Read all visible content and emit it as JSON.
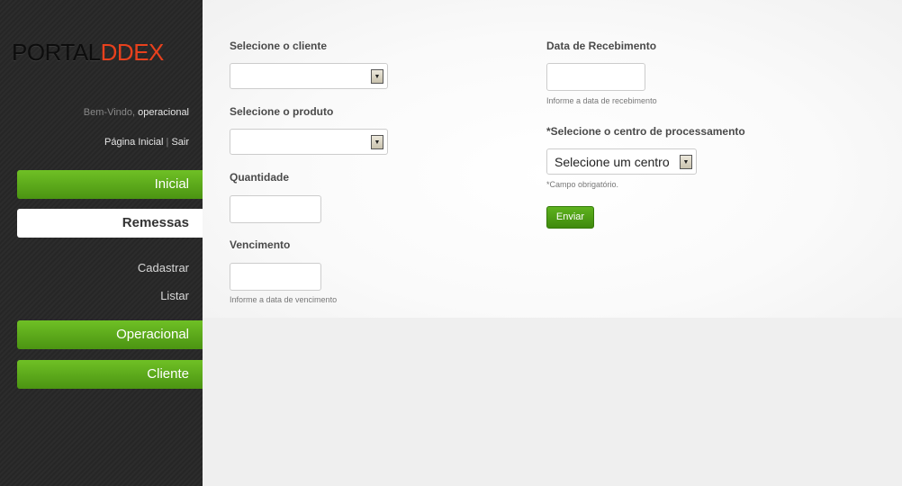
{
  "brand": {
    "part1": "PORTAL",
    "part2": "DDEX"
  },
  "welcome": {
    "prefix": "Bem-Vindo, ",
    "user": "operacional"
  },
  "links": {
    "home": "Página Inicial",
    "separator": " | ",
    "logout": "Sair"
  },
  "nav": {
    "inicial": "Inicial",
    "remessas": "Remessas",
    "cadastrar": "Cadastrar",
    "listar": "Listar",
    "operacional": "Operacional",
    "cliente": "Cliente"
  },
  "form": {
    "cliente_label": "Selecione o cliente",
    "cliente_value": "",
    "produto_label": "Selecione o produto",
    "produto_value": "",
    "quantidade_label": "Quantidade",
    "quantidade_value": "",
    "vencimento_label": "Vencimento",
    "vencimento_value": "",
    "vencimento_hint": "Informe a data de vencimento",
    "recebimento_label": "Data de Recebimento",
    "recebimento_value": "",
    "recebimento_hint": "Informe a data de recebimento",
    "centro_label": "*Selecione o centro de processamento",
    "centro_value": "Selecione um centro",
    "centro_hint": "*Campo obrigatório.",
    "submit": "Enviar"
  },
  "colors": {
    "accent_green": "#5eb21e",
    "brand_red": "#e8411d",
    "sidebar_bg": "#2a2a2a"
  },
  "icons": {
    "select_arrow": "dropdown-arrow-icon"
  }
}
